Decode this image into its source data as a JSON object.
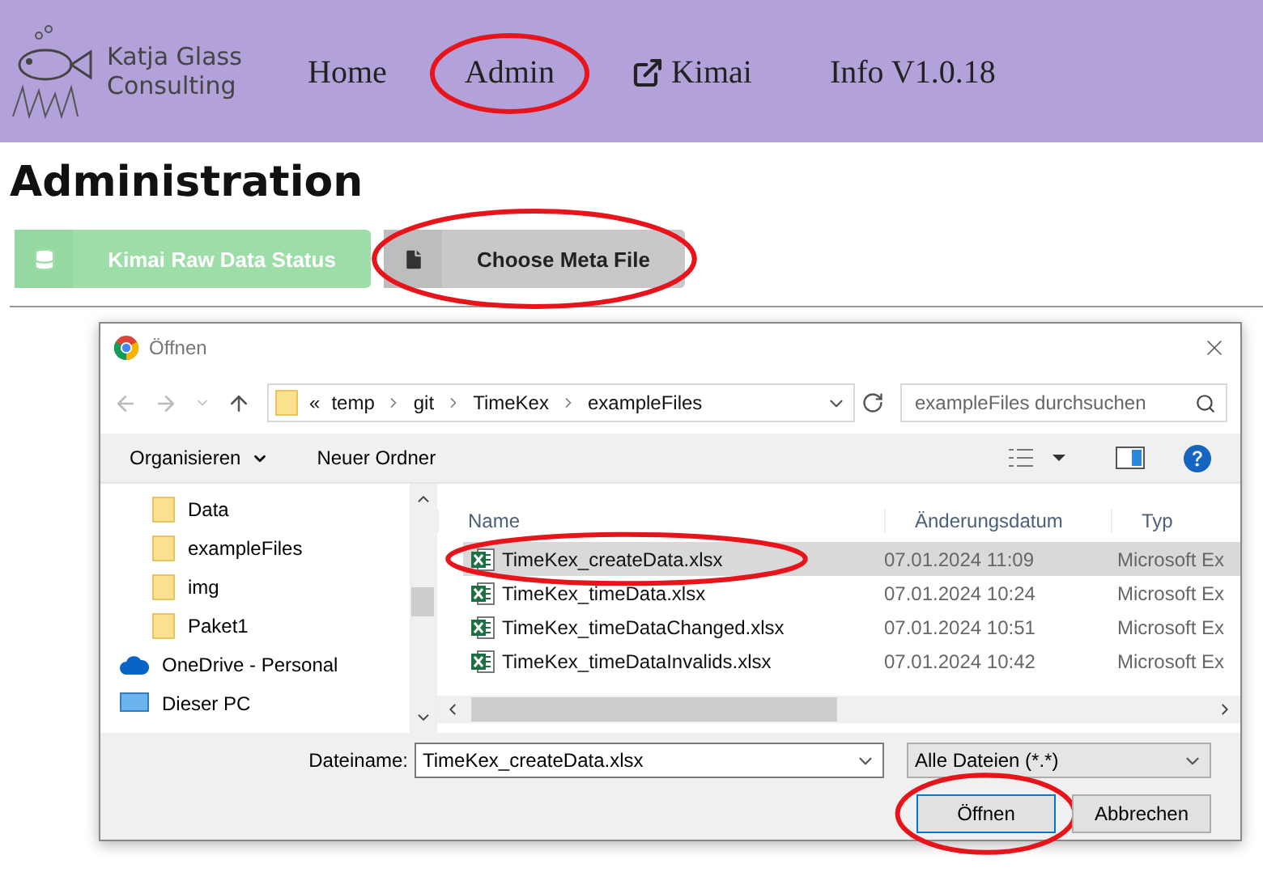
{
  "header": {
    "logo": {
      "line1": "Katja Glass",
      "line2": "Consulting"
    },
    "nav": [
      {
        "label": "Home",
        "circled": false,
        "external": false
      },
      {
        "label": "Admin",
        "circled": true,
        "external": false
      },
      {
        "label": "Kimai",
        "circled": false,
        "external": true
      },
      {
        "label": "Info V1.0.18",
        "circled": false,
        "external": false
      }
    ]
  },
  "title": "Administration",
  "actions": [
    {
      "kind": "database",
      "label": "Kimai Raw Data Status",
      "circled": false
    },
    {
      "kind": "file",
      "label": "Choose Meta File",
      "circled": true
    }
  ],
  "dialog": {
    "title": "Öffnen",
    "path_prefix": "«",
    "path": [
      "temp",
      "git",
      "TimeKex",
      "exampleFiles"
    ],
    "search": {
      "placeholder": "exampleFiles durchsuchen"
    },
    "toolbar": [
      "Organisieren",
      "Neuer Ordner"
    ],
    "tree": [
      {
        "kind": "folder",
        "label": "Data"
      },
      {
        "kind": "folder",
        "label": "exampleFiles"
      },
      {
        "kind": "folder",
        "label": "img"
      },
      {
        "kind": "folder",
        "label": "Paket1"
      },
      {
        "kind": "cloud",
        "label": "OneDrive - Personal"
      },
      {
        "kind": "pc",
        "label": "Dieser PC"
      }
    ],
    "columns": [
      "Name",
      "Änderungsdatum",
      "Typ"
    ],
    "files": [
      {
        "name": "TimeKex_createData.xlsx",
        "date": "07.01.2024 11:09",
        "type": "Microsoft Ex",
        "selected": true,
        "circled": true
      },
      {
        "name": "TimeKex_timeData.xlsx",
        "date": "07.01.2024 10:24",
        "type": "Microsoft Ex",
        "selected": false,
        "circled": false
      },
      {
        "name": "TimeKex_timeDataChanged.xlsx",
        "date": "07.01.2024 10:51",
        "type": "Microsoft Ex",
        "selected": false,
        "circled": false
      },
      {
        "name": "TimeKex_timeDataInvalids.xlsx",
        "date": "07.01.2024 10:42",
        "type": "Microsoft Ex",
        "selected": false,
        "circled": false
      }
    ],
    "filename_label": "Dateiname:",
    "filename": "TimeKex_createData.xlsx",
    "filter": "Alle Dateien (*.*)",
    "buttons": [
      {
        "label": "Öffnen",
        "circled": true,
        "default": true
      },
      {
        "label": "Abbrechen",
        "circled": false,
        "default": false
      }
    ]
  }
}
